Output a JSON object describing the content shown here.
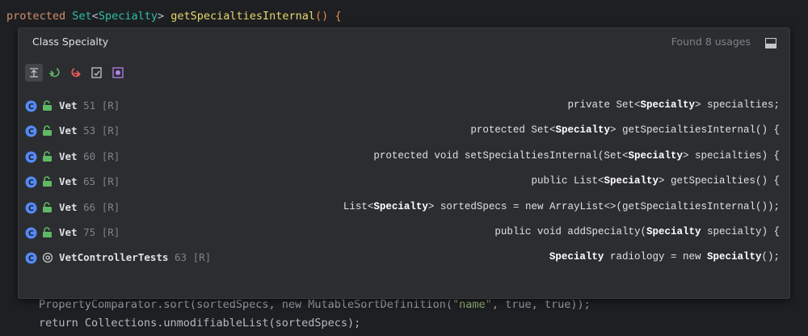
{
  "editor": {
    "top_line": {
      "kw": "protected ",
      "type1": "Set",
      "lt": "<",
      "type2": "Specialty",
      "gt": "> ",
      "fn": "getSpecialtiesInternal",
      "paren": "() ",
      "brace": "{"
    },
    "bottom_line1": {
      "a": "PropertyComparator.sort(sortedSpecs, new MutableSortDefinition(",
      "str": "\"name\"",
      "b": ", true, true));"
    },
    "bottom_line2": "return Collections.unmodifiableList(sortedSpecs);"
  },
  "popup": {
    "title": "Class Specialty",
    "found": "Found 8 usages",
    "toolbar": [
      "collapse-all-icon",
      "previous-occurrence-icon",
      "next-occurrence-icon",
      "group-by-icon",
      "filter-icon"
    ],
    "rows": [
      {
        "file": "Vet",
        "line": "51",
        "flag": "[R]",
        "pre": "private Set<",
        "bold": "Specialty",
        "post": "> specialties;",
        "bold2": "",
        "post2": "",
        "kind": "class"
      },
      {
        "file": "Vet",
        "line": "53",
        "flag": "[R]",
        "pre": "protected Set<",
        "bold": "Specialty",
        "post": "> getSpecialtiesInternal() {",
        "bold2": "",
        "post2": "",
        "kind": "class"
      },
      {
        "file": "Vet",
        "line": "60",
        "flag": "[R]",
        "pre": "protected void setSpecialtiesInternal(Set<",
        "bold": "Specialty",
        "post": "> specialties) {",
        "bold2": "",
        "post2": "",
        "kind": "class"
      },
      {
        "file": "Vet",
        "line": "65",
        "flag": "[R]",
        "pre": "public List<",
        "bold": "Specialty",
        "post": "> getSpecialties() {",
        "bold2": "",
        "post2": "",
        "kind": "class"
      },
      {
        "file": "Vet",
        "line": "66",
        "flag": "[R]",
        "pre": "List<",
        "bold": "Specialty",
        "post": "> sortedSpecs = new ArrayList<>(getSpecialtiesInternal());",
        "bold2": "",
        "post2": "",
        "kind": "class"
      },
      {
        "file": "Vet",
        "line": "75",
        "flag": "[R]",
        "pre": "public void addSpecialty(",
        "bold": "Specialty",
        "post": " specialty) {",
        "bold2": "",
        "post2": "",
        "kind": "class"
      },
      {
        "file": "VetControllerTests",
        "line": "63",
        "flag": "[R]",
        "pre": "",
        "bold": "Specialty",
        "post": " radiology = new ",
        "bold2": "Specialty",
        "post2": "();",
        "kind": "test"
      }
    ]
  },
  "colors": {
    "class_icon": "#548af7",
    "lock_icon": "#5fb865",
    "background": "#1e1f22",
    "popup": "#2b2d30"
  }
}
